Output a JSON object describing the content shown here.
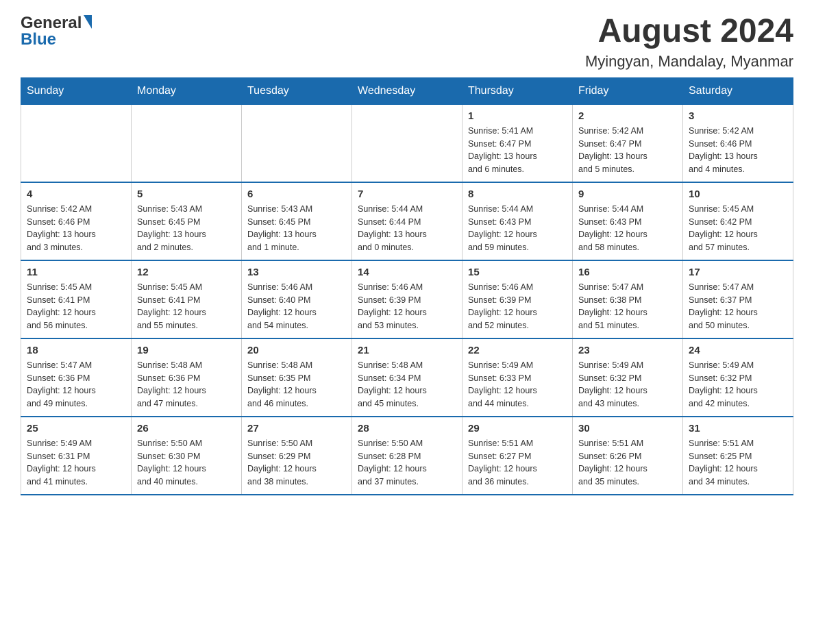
{
  "header": {
    "logo_general": "General",
    "logo_blue": "Blue",
    "month": "August 2024",
    "location": "Myingyan, Mandalay, Myanmar"
  },
  "days_of_week": [
    "Sunday",
    "Monday",
    "Tuesday",
    "Wednesday",
    "Thursday",
    "Friday",
    "Saturday"
  ],
  "weeks": [
    [
      {
        "day": "",
        "info": ""
      },
      {
        "day": "",
        "info": ""
      },
      {
        "day": "",
        "info": ""
      },
      {
        "day": "",
        "info": ""
      },
      {
        "day": "1",
        "info": "Sunrise: 5:41 AM\nSunset: 6:47 PM\nDaylight: 13 hours\nand 6 minutes."
      },
      {
        "day": "2",
        "info": "Sunrise: 5:42 AM\nSunset: 6:47 PM\nDaylight: 13 hours\nand 5 minutes."
      },
      {
        "day": "3",
        "info": "Sunrise: 5:42 AM\nSunset: 6:46 PM\nDaylight: 13 hours\nand 4 minutes."
      }
    ],
    [
      {
        "day": "4",
        "info": "Sunrise: 5:42 AM\nSunset: 6:46 PM\nDaylight: 13 hours\nand 3 minutes."
      },
      {
        "day": "5",
        "info": "Sunrise: 5:43 AM\nSunset: 6:45 PM\nDaylight: 13 hours\nand 2 minutes."
      },
      {
        "day": "6",
        "info": "Sunrise: 5:43 AM\nSunset: 6:45 PM\nDaylight: 13 hours\nand 1 minute."
      },
      {
        "day": "7",
        "info": "Sunrise: 5:44 AM\nSunset: 6:44 PM\nDaylight: 13 hours\nand 0 minutes."
      },
      {
        "day": "8",
        "info": "Sunrise: 5:44 AM\nSunset: 6:43 PM\nDaylight: 12 hours\nand 59 minutes."
      },
      {
        "day": "9",
        "info": "Sunrise: 5:44 AM\nSunset: 6:43 PM\nDaylight: 12 hours\nand 58 minutes."
      },
      {
        "day": "10",
        "info": "Sunrise: 5:45 AM\nSunset: 6:42 PM\nDaylight: 12 hours\nand 57 minutes."
      }
    ],
    [
      {
        "day": "11",
        "info": "Sunrise: 5:45 AM\nSunset: 6:41 PM\nDaylight: 12 hours\nand 56 minutes."
      },
      {
        "day": "12",
        "info": "Sunrise: 5:45 AM\nSunset: 6:41 PM\nDaylight: 12 hours\nand 55 minutes."
      },
      {
        "day": "13",
        "info": "Sunrise: 5:46 AM\nSunset: 6:40 PM\nDaylight: 12 hours\nand 54 minutes."
      },
      {
        "day": "14",
        "info": "Sunrise: 5:46 AM\nSunset: 6:39 PM\nDaylight: 12 hours\nand 53 minutes."
      },
      {
        "day": "15",
        "info": "Sunrise: 5:46 AM\nSunset: 6:39 PM\nDaylight: 12 hours\nand 52 minutes."
      },
      {
        "day": "16",
        "info": "Sunrise: 5:47 AM\nSunset: 6:38 PM\nDaylight: 12 hours\nand 51 minutes."
      },
      {
        "day": "17",
        "info": "Sunrise: 5:47 AM\nSunset: 6:37 PM\nDaylight: 12 hours\nand 50 minutes."
      }
    ],
    [
      {
        "day": "18",
        "info": "Sunrise: 5:47 AM\nSunset: 6:36 PM\nDaylight: 12 hours\nand 49 minutes."
      },
      {
        "day": "19",
        "info": "Sunrise: 5:48 AM\nSunset: 6:36 PM\nDaylight: 12 hours\nand 47 minutes."
      },
      {
        "day": "20",
        "info": "Sunrise: 5:48 AM\nSunset: 6:35 PM\nDaylight: 12 hours\nand 46 minutes."
      },
      {
        "day": "21",
        "info": "Sunrise: 5:48 AM\nSunset: 6:34 PM\nDaylight: 12 hours\nand 45 minutes."
      },
      {
        "day": "22",
        "info": "Sunrise: 5:49 AM\nSunset: 6:33 PM\nDaylight: 12 hours\nand 44 minutes."
      },
      {
        "day": "23",
        "info": "Sunrise: 5:49 AM\nSunset: 6:32 PM\nDaylight: 12 hours\nand 43 minutes."
      },
      {
        "day": "24",
        "info": "Sunrise: 5:49 AM\nSunset: 6:32 PM\nDaylight: 12 hours\nand 42 minutes."
      }
    ],
    [
      {
        "day": "25",
        "info": "Sunrise: 5:49 AM\nSunset: 6:31 PM\nDaylight: 12 hours\nand 41 minutes."
      },
      {
        "day": "26",
        "info": "Sunrise: 5:50 AM\nSunset: 6:30 PM\nDaylight: 12 hours\nand 40 minutes."
      },
      {
        "day": "27",
        "info": "Sunrise: 5:50 AM\nSunset: 6:29 PM\nDaylight: 12 hours\nand 38 minutes."
      },
      {
        "day": "28",
        "info": "Sunrise: 5:50 AM\nSunset: 6:28 PM\nDaylight: 12 hours\nand 37 minutes."
      },
      {
        "day": "29",
        "info": "Sunrise: 5:51 AM\nSunset: 6:27 PM\nDaylight: 12 hours\nand 36 minutes."
      },
      {
        "day": "30",
        "info": "Sunrise: 5:51 AM\nSunset: 6:26 PM\nDaylight: 12 hours\nand 35 minutes."
      },
      {
        "day": "31",
        "info": "Sunrise: 5:51 AM\nSunset: 6:25 PM\nDaylight: 12 hours\nand 34 minutes."
      }
    ]
  ]
}
